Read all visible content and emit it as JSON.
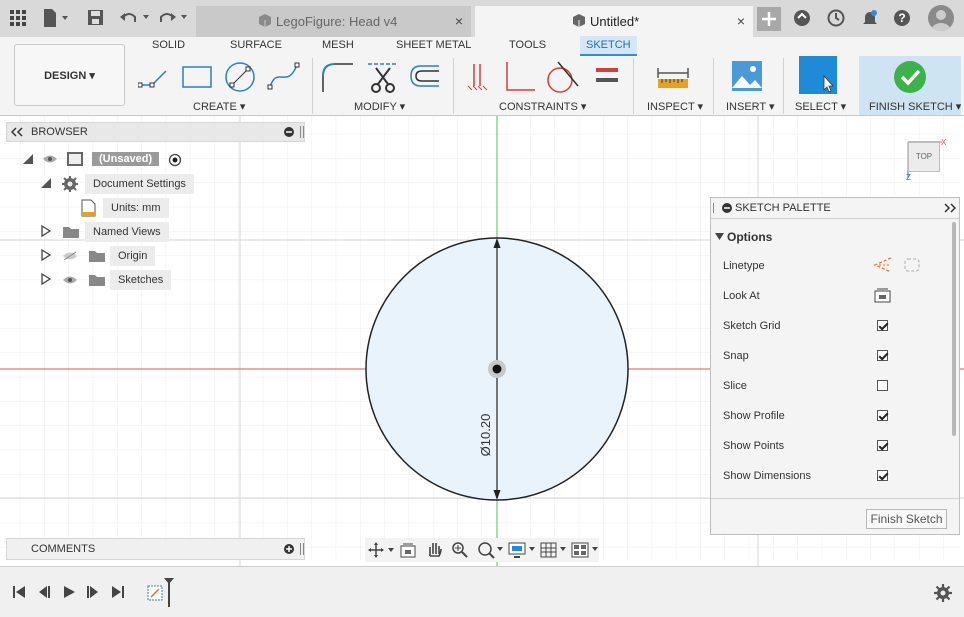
{
  "window": {
    "inactive_tab_label": "LegoFigure: Head v4",
    "active_tab_label": "Untitled*",
    "close_glyph": "×"
  },
  "ribbon": {
    "workspace_label": "DESIGN ▾",
    "tabs": [
      "SOLID",
      "SURFACE",
      "MESH",
      "SHEET METAL",
      "TOOLS",
      "SKETCH"
    ],
    "active_tab": "SKETCH",
    "groups": {
      "create": "CREATE ▾",
      "modify": "MODIFY ▾",
      "constraints": "CONSTRAINTS ▾",
      "inspect": "INSPECT ▾",
      "insert": "INSERT ▾",
      "select": "SELECT ▾",
      "finish": "FINISH SKETCH ▾"
    }
  },
  "browser": {
    "title": "BROWSER",
    "items": [
      {
        "label": "(Unsaved)"
      },
      {
        "label": "Document Settings"
      },
      {
        "label": "Units: mm"
      },
      {
        "label": "Named Views"
      },
      {
        "label": "Origin"
      },
      {
        "label": "Sketches"
      }
    ]
  },
  "comments": {
    "title": "COMMENTS"
  },
  "canvas": {
    "dimension_label": "Ø10.20",
    "viewcube_label": "TOP",
    "axis_x_label": "X",
    "axis_z_label": "Z"
  },
  "palette": {
    "title": "SKETCH PALETTE",
    "section": "Options",
    "rows": [
      {
        "label": "Linetype",
        "kind": "icons"
      },
      {
        "label": "Look At",
        "kind": "icon"
      },
      {
        "label": "Sketch Grid",
        "kind": "check",
        "checked": true
      },
      {
        "label": "Snap",
        "kind": "check",
        "checked": true
      },
      {
        "label": "Slice",
        "kind": "check",
        "checked": false
      },
      {
        "label": "Show Profile",
        "kind": "check",
        "checked": true
      },
      {
        "label": "Show Points",
        "kind": "check",
        "checked": true
      },
      {
        "label": "Show Dimensions",
        "kind": "check",
        "checked": true
      }
    ],
    "finish_button": "Finish Sketch"
  },
  "colors": {
    "accent": "#2e8fd6",
    "finish_green": "#3cb34a",
    "select_blue": "#1f8ad6",
    "x_axis": "#e04040",
    "y_axis": "#40c040",
    "circle_fill": "#e8f3fb"
  }
}
